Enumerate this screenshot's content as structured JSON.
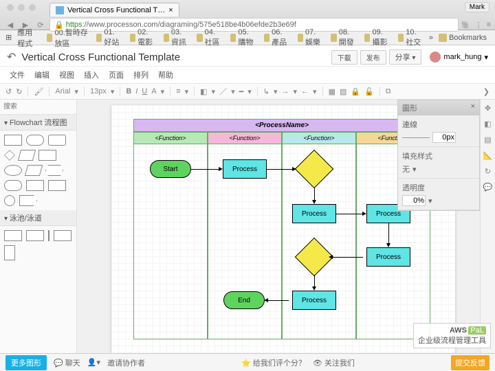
{
  "browser": {
    "tab_title": "Vertical Cross Functional T…",
    "url_prefix": "https",
    "url": "://www.processon.com/diagraming/575e518be4b06efde2b3e69f",
    "mac_user": "Mark"
  },
  "bookmarks": [
    "應用程式",
    "00.暫時存放區",
    "01.好站",
    "02.電影",
    "03.資訊",
    "04.社區",
    "05.購物",
    "06.產品",
    "07.娛樂",
    "08.開發",
    "09.攝影",
    "10.社交",
    "Bookmarks"
  ],
  "doc": {
    "title": "Vertical Cross Functional Template",
    "user": "mark_hung"
  },
  "actions": {
    "download": "下載",
    "publish": "发布",
    "share": "分享"
  },
  "menus": [
    "文件",
    "编辑",
    "视图",
    "插入",
    "页面",
    "排列",
    "帮助"
  ],
  "toolbar": {
    "font": "Arial",
    "size": "13px"
  },
  "sidebar": {
    "search_ph": "搜索",
    "flowchart": "Flowchart 流程图",
    "swimlane": "泳池/泳道"
  },
  "diagram": {
    "process_name": "<ProcessName>",
    "functions": [
      "<Function>",
      "<Function>",
      "<Function>",
      "<Function>"
    ],
    "start": "Start",
    "process": "Process",
    "end": "End"
  },
  "right": {
    "title": "圖形",
    "line": "連線",
    "fill": "填充样式",
    "none": "无",
    "opacity": "透明度",
    "px": "0px",
    "pct": "0%"
  },
  "footer": {
    "more": "更多图形",
    "chat": "聊天",
    "invite": "邀请协作者",
    "rate": "给我们评个分？",
    "follow": "关注我们",
    "feedback": "提交反馈"
  },
  "logo": {
    "brand": "AWS",
    "sub": "PaL",
    "tagline": "企业级流程管理工具"
  }
}
